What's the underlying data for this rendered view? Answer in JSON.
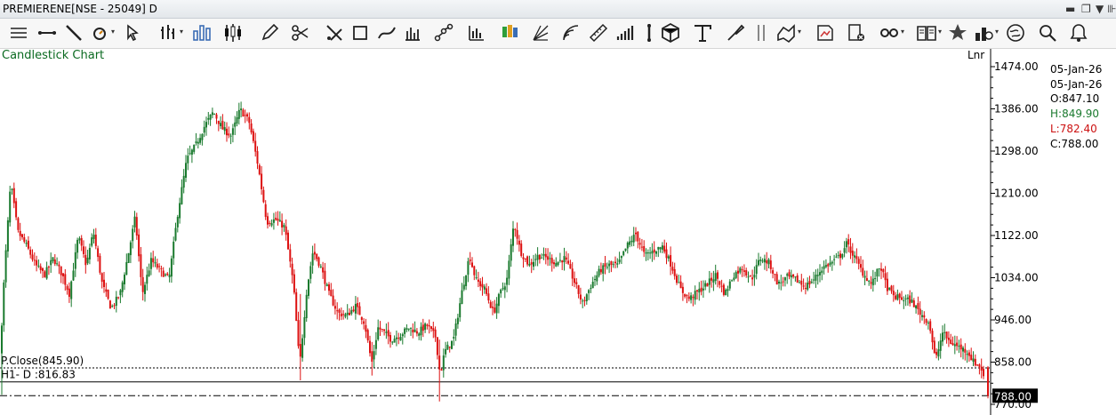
{
  "window": {
    "title": "PREMIERENE[NSE - 25049] D"
  },
  "toolbar": {
    "icons": [
      "menu-lines-icon",
      "horizontal-line-icon",
      "trend-line-icon",
      "indicator-icon",
      "cursor-icon",
      "bar-type-icon",
      "bar-chart-icon",
      "candlestick-icon",
      "pencil-icon",
      "scissors-icon",
      "tools-icon",
      "rectangle-icon",
      "curve-icon",
      "volume-bars-icon",
      "scatter-icon",
      "histogram-icon",
      "candle-color-icon",
      "fan-icon",
      "arc-icon",
      "ruler-icon",
      "volume-steps-icon",
      "vertical-line-icon",
      "cube-icon",
      "text-icon",
      "brush-icon",
      "double-line-icon",
      "drawing-icon",
      "chart-edit-icon",
      "delete-chart-icon",
      "link-icon",
      "book-icon",
      "star-icon",
      "layout-icon",
      "globe-icon",
      "search-icon",
      "alert-icon"
    ]
  },
  "chart_label": "Candlestick Chart",
  "scale_label": "Lnr",
  "ohlc_panel": {
    "date1": "05-Jan-26",
    "date2": "05-Jan-26",
    "open": "O:847.10",
    "high": "H:849.90",
    "low": "L:782.40",
    "close": "C:788.00"
  },
  "colors": {
    "up": "#1a7a2e",
    "down": "#dd1111",
    "ohlc_high": "#1a7a2e",
    "ohlc_low": "#cc1111"
  },
  "chart_data": {
    "type": "candlestick",
    "yaxis_ticks": [
      1474,
      1386,
      1298,
      1210,
      1122,
      1034,
      946,
      858,
      770
    ],
    "yaxis_tick_labels": [
      "1474.00",
      "1386.00",
      "1298.00",
      "1210.00",
      "1122.00",
      "1034.00",
      "946.00",
      "858.00",
      "770.00"
    ],
    "ylim": [
      770,
      1474
    ],
    "last_price_label": "788.00",
    "last_price": 788,
    "lines": [
      {
        "label": "P.Close(845.90)",
        "value": 845.9,
        "style": "dotted"
      },
      {
        "label": "H1- D :816.83",
        "value": 816.83,
        "style": "solid"
      },
      {
        "label": "",
        "value": 788,
        "style": "dashdot"
      }
    ],
    "close_path": [
      [
        0,
        872
      ],
      [
        5,
        1045
      ],
      [
        12,
        1232
      ],
      [
        20,
        1130
      ],
      [
        30,
        1100
      ],
      [
        40,
        1060
      ],
      [
        50,
        1040
      ],
      [
        60,
        1075
      ],
      [
        70,
        1040
      ],
      [
        78,
        1000
      ],
      [
        88,
        1120
      ],
      [
        97,
        1060
      ],
      [
        105,
        1130
      ],
      [
        115,
        1020
      ],
      [
        125,
        970
      ],
      [
        135,
        1000
      ],
      [
        145,
        1090
      ],
      [
        152,
        1160
      ],
      [
        160,
        1000
      ],
      [
        170,
        1070
      ],
      [
        180,
        1050
      ],
      [
        190,
        1030
      ],
      [
        200,
        1170
      ],
      [
        210,
        1280
      ],
      [
        220,
        1310
      ],
      [
        230,
        1350
      ],
      [
        240,
        1380
      ],
      [
        250,
        1345
      ],
      [
        260,
        1330
      ],
      [
        270,
        1385
      ],
      [
        280,
        1360
      ],
      [
        290,
        1270
      ],
      [
        300,
        1150
      ],
      [
        310,
        1155
      ],
      [
        320,
        1140
      ],
      [
        330,
        1020
      ],
      [
        337,
        850
      ],
      [
        345,
        1010
      ],
      [
        352,
        1090
      ],
      [
        360,
        1060
      ],
      [
        370,
        1000
      ],
      [
        380,
        960
      ],
      [
        390,
        955
      ],
      [
        400,
        975
      ],
      [
        410,
        940
      ],
      [
        418,
        855
      ],
      [
        425,
        930
      ],
      [
        432,
        920
      ],
      [
        440,
        905
      ],
      [
        450,
        915
      ],
      [
        460,
        930
      ],
      [
        470,
        920
      ],
      [
        480,
        935
      ],
      [
        490,
        910
      ],
      [
        495,
        830
      ],
      [
        500,
        880
      ],
      [
        510,
        905
      ],
      [
        520,
        1010
      ],
      [
        528,
        1080
      ],
      [
        535,
        1030
      ],
      [
        545,
        1010
      ],
      [
        555,
        960
      ],
      [
        562,
        1000
      ],
      [
        570,
        1030
      ],
      [
        578,
        1150
      ],
      [
        585,
        1090
      ],
      [
        595,
        1060
      ],
      [
        605,
        1080
      ],
      [
        615,
        1075
      ],
      [
        625,
        1065
      ],
      [
        635,
        1075
      ],
      [
        645,
        1030
      ],
      [
        655,
        980
      ],
      [
        665,
        1020
      ],
      [
        675,
        1050
      ],
      [
        685,
        1060
      ],
      [
        695,
        1060
      ],
      [
        705,
        1100
      ],
      [
        715,
        1125
      ],
      [
        725,
        1080
      ],
      [
        735,
        1090
      ],
      [
        745,
        1100
      ],
      [
        755,
        1060
      ],
      [
        765,
        1010
      ],
      [
        775,
        990
      ],
      [
        785,
        1005
      ],
      [
        795,
        1020
      ],
      [
        805,
        1040
      ],
      [
        815,
        1000
      ],
      [
        825,
        1040
      ],
      [
        835,
        1055
      ],
      [
        845,
        1030
      ],
      [
        855,
        1075
      ],
      [
        865,
        1065
      ],
      [
        875,
        1020
      ],
      [
        885,
        1035
      ],
      [
        895,
        1030
      ],
      [
        905,
        1015
      ],
      [
        915,
        1030
      ],
      [
        925,
        1055
      ],
      [
        935,
        1065
      ],
      [
        945,
        1080
      ],
      [
        952,
        1105
      ],
      [
        960,
        1080
      ],
      [
        970,
        1045
      ],
      [
        980,
        1020
      ],
      [
        990,
        1060
      ],
      [
        997,
        1015
      ],
      [
        1005,
        995
      ],
      [
        1015,
        990
      ],
      [
        1025,
        985
      ],
      [
        1035,
        960
      ],
      [
        1045,
        940
      ],
      [
        1052,
        860
      ],
      [
        1060,
        920
      ],
      [
        1068,
        900
      ],
      [
        1078,
        890
      ],
      [
        1088,
        880
      ],
      [
        1095,
        858
      ],
      [
        1103,
        848
      ],
      [
        1111,
        788
      ]
    ]
  }
}
